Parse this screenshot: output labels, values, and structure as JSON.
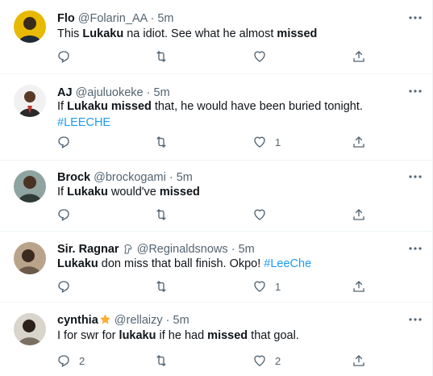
{
  "timeline": {
    "tweets": [
      {
        "name": "Flo",
        "handle": "@Folarin_AA",
        "dot": "·",
        "time": "5m",
        "text": [
          {
            "t": "This ",
            "b": false
          },
          {
            "t": "Lukaku",
            "b": true
          },
          {
            "t": " na idiot. See what he almost ",
            "b": false
          },
          {
            "t": "missed",
            "b": true
          }
        ],
        "text_line2": [],
        "reply_count": "",
        "retweet_count": "",
        "like_count": ""
      },
      {
        "name": "AJ",
        "handle": "@ajuluokeke",
        "dot": "·",
        "time": "5m",
        "text": [
          {
            "t": "If ",
            "b": false
          },
          {
            "t": "Lukaku",
            "b": true
          },
          {
            "t": " ",
            "b": false
          },
          {
            "t": "missed",
            "b": true
          },
          {
            "t": " that, he would have been buried tonight.",
            "b": false
          }
        ],
        "text_line2": [
          {
            "t": "#LEECHE",
            "b": false,
            "tag": true
          }
        ],
        "reply_count": "",
        "retweet_count": "",
        "like_count": "1"
      },
      {
        "name": "Brock",
        "handle": "@brockogami",
        "dot": "·",
        "time": "5m",
        "text": [
          {
            "t": "If ",
            "b": false
          },
          {
            "t": "Lukaku",
            "b": true
          },
          {
            "t": " would've ",
            "b": false
          },
          {
            "t": "missed",
            "b": true
          }
        ],
        "text_line2": [],
        "reply_count": "",
        "retweet_count": "",
        "like_count": ""
      },
      {
        "name": "Sir. Ragnar",
        "handle": "@Reginaldsnows",
        "dot": "·",
        "time": "5m",
        "badge": "horse-emoji",
        "text": [
          {
            "t": "Lukaku",
            "b": true
          },
          {
            "t": " don miss that ball finish. Okpo! ",
            "b": false
          },
          {
            "t": "#LeeChe",
            "b": false,
            "tag": true
          }
        ],
        "text_line2": [],
        "reply_count": "",
        "retweet_count": "",
        "like_count": "1"
      },
      {
        "name": "cynthia",
        "handle": "@rellaizy",
        "dot": "·",
        "time": "5m",
        "badge": "star-emoji",
        "text": [
          {
            "t": "I for swr for ",
            "b": false
          },
          {
            "t": "lukaku",
            "b": true
          },
          {
            "t": " if he had ",
            "b": false
          },
          {
            "t": "missed",
            "b": true
          },
          {
            "t": " that goal.",
            "b": false
          }
        ],
        "text_line2": [],
        "reply_count": "2",
        "retweet_count": "",
        "like_count": "2"
      }
    ]
  },
  "icons": {
    "reply": "reply-icon",
    "retweet": "retweet-icon",
    "like": "heart-icon",
    "share": "share-icon",
    "more": "more-icon"
  },
  "colors": {
    "text": "#0f1419",
    "muted": "#536471",
    "link": "#1d9bf0",
    "divider": "#eff3f4"
  }
}
